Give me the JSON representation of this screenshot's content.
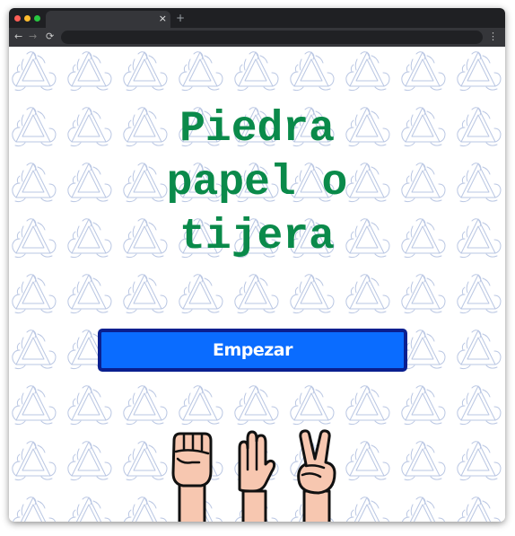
{
  "browser": {
    "tab_close": "×",
    "new_tab": "+",
    "nav_back": "←",
    "nav_forward": "→",
    "nav_reload": "⟳",
    "menu": "⋮"
  },
  "page": {
    "title_lines": [
      "Piedra",
      "papel o",
      "tijera"
    ],
    "start_button": "Empezar"
  },
  "hands": [
    "fist-rock-icon",
    "open-hand-paper-icon",
    "peace-sign-scissors-icon"
  ],
  "colors": {
    "title": "#0a8a4a",
    "button_bg": "#0a6cff",
    "button_border": "#0a1f8f",
    "pattern_stroke": "#aebdde",
    "skin": "#f7c7b0"
  }
}
